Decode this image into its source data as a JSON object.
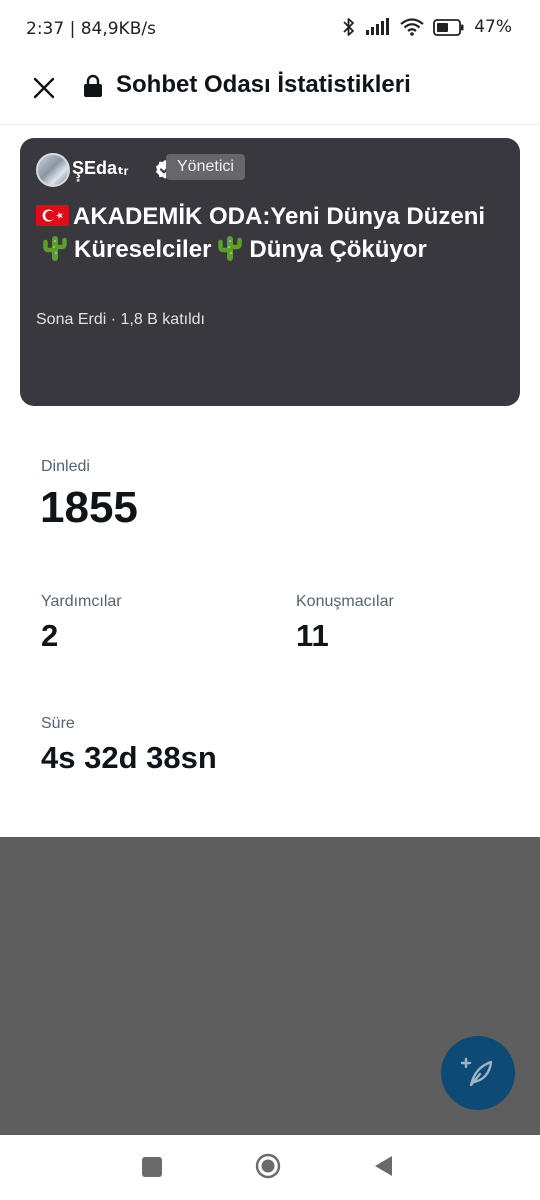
{
  "status_bar": {
    "time": "2:37 | 84,9KB/s",
    "battery": "47%"
  },
  "header": {
    "title": "Sohbet Odası İstatistikleri"
  },
  "room": {
    "host_name": "Ş͙Edaₜᵣ",
    "role_badge": "Yönetici",
    "title_part1": "AKADEMİK ODA:Yeni Dünya Düzeni",
    "title_part2": "Küreselciler",
    "title_part3": "Dünya Çöküyor",
    "meta": "Sona Erdi · 1,8 B katıldı"
  },
  "stats": {
    "listened_label": "Dinledi",
    "listened_value": "1855",
    "cohosts_label": "Yardımcılar",
    "cohosts_value": "2",
    "speakers_label": "Konuşmacılar",
    "speakers_value": "11",
    "duration_label": "Süre",
    "duration_value": "4s 32d 38sn"
  },
  "colors": {
    "card_bg": "#3a383f",
    "overlay": "#5e5e5e",
    "fab": "#0d4a75",
    "label_gray": "#536471",
    "badge_blue": "#1d9bf0"
  },
  "icons": [
    "close-icon",
    "lock-icon",
    "verified-icon",
    "turkey-flag-icon",
    "cactus-icon",
    "compose-spaces-icon",
    "bluetooth-icon",
    "signal-icon",
    "wifi-icon",
    "battery-icon"
  ]
}
